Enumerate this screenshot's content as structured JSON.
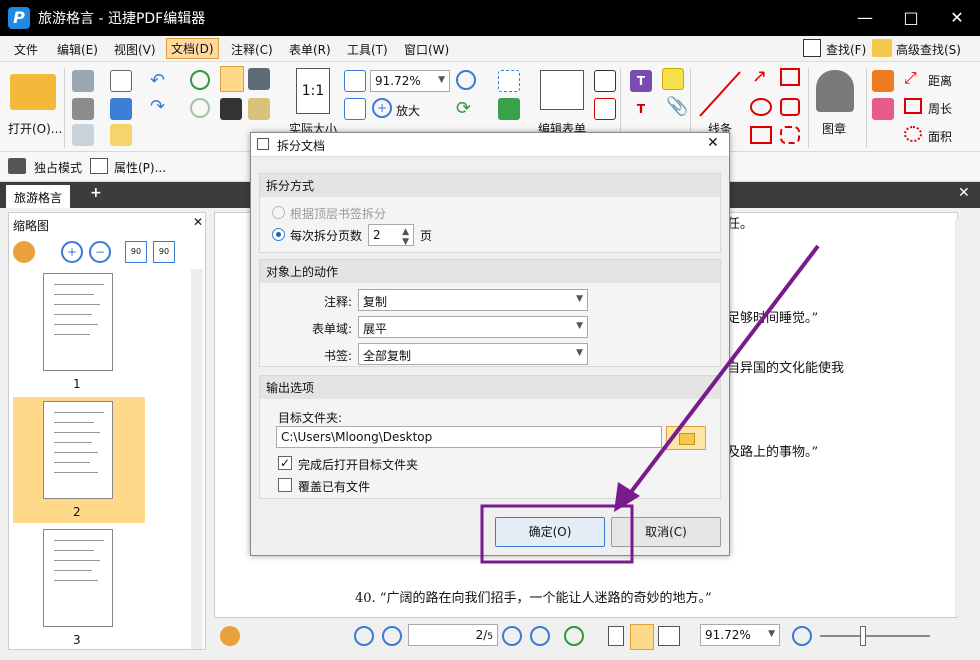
{
  "window": {
    "title": "旅游格言 - 迅捷PDF编辑器",
    "logo": "P"
  },
  "menu": [
    "文件",
    "编辑(E)",
    "视图(V)",
    "文档(D)",
    "注释(C)",
    "表单(R)",
    "工具(T)",
    "窗口(W)"
  ],
  "menu_right": {
    "find": "查找(F)",
    "advanced_find": "高级查找(S)"
  },
  "ribbon": {
    "open": "打开(O)...",
    "zoom": "91.72%",
    "zoom_in": "放大",
    "actual_size": "实际大小",
    "edit_form": "编辑表单",
    "line": "线条",
    "stamp": "图章",
    "distance": "距离",
    "perimeter": "周长",
    "area": "面积"
  },
  "subbar": {
    "exclusive": "独占模式",
    "properties": "属性(P)..."
  },
  "tab": {
    "name": "旅游格言"
  },
  "thumbnails": {
    "title": "缩略图",
    "pages": [
      "1",
      "2",
      "3"
    ],
    "rot_left": "90",
    "rot_right": "90"
  },
  "document": {
    "lines": [
      "任。",
      "足够时间睡觉。”",
      "自异国的文化能使我",
      "及路上的事物。”",
      "40. “广阔的路在向我们招手，一个能让人迷路的奇妙的地方。”"
    ]
  },
  "navbar": {
    "page": "2",
    "total": "5",
    "zoom": "91.72%"
  },
  "dialog": {
    "title": "拆分文档",
    "split_group": "拆分方式",
    "opt_bookmark": "根据顶层书签拆分",
    "opt_pages": "每次拆分页数",
    "pages_value": "2",
    "pages_unit": "页",
    "objects_group": "对象上的动作",
    "annot_label": "注释:",
    "annot_value": "复制",
    "form_label": "表单域:",
    "form_value": "展平",
    "bookmark_label": "书签:",
    "bookmark_value": "全部复制",
    "output_group": "输出选项",
    "folder_label": "目标文件夹:",
    "folder_value": "C:\\Users\\Mloong\\Desktop",
    "open_after": "完成后打开目标文件夹",
    "overwrite": "覆盖已有文件",
    "ok": "确定(O)",
    "cancel": "取消(C)"
  },
  "colors": {
    "annotation": "#7a1b8c",
    "accent": "#1e88e5",
    "selection": "#ffd98a"
  }
}
